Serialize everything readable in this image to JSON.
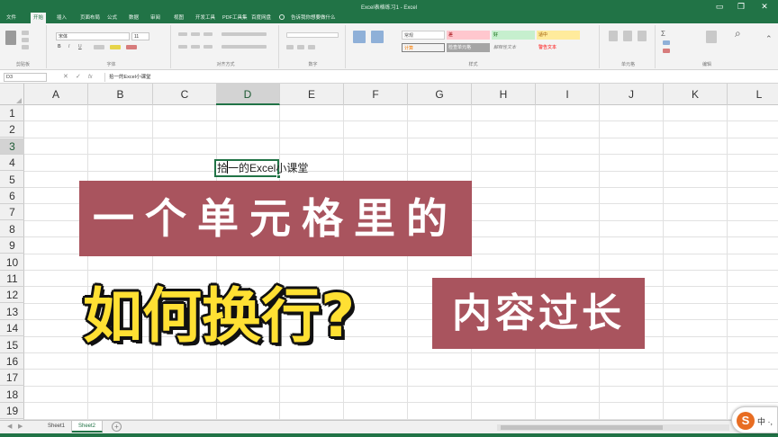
{
  "window": {
    "title": "Excel表格练习1 - Excel",
    "controls": {
      "restore": "❐",
      "close": "✕"
    }
  },
  "tabs": [
    "文件",
    "开始",
    "插入",
    "页面布局",
    "公式",
    "数据",
    "审阅",
    "视图",
    "开发工具",
    "PDF工具集",
    "百度网盘",
    "告诉我你想要做什么"
  ],
  "ribbon": {
    "groups": [
      "剪贴板",
      "字体",
      "对齐方式",
      "数字",
      "样式",
      "单元格",
      "编辑"
    ],
    "font_name": "宋体",
    "font_size": "11",
    "styles": [
      "常规",
      "差",
      "好",
      "适中",
      "计算",
      "检查单元格",
      "解释性文本",
      "警告文本"
    ]
  },
  "formula_bar": {
    "name_box": "D3",
    "cancel_icon": "✕",
    "enter_icon": "✓",
    "fx_icon": "fx",
    "value": "拾一的Excel小课堂"
  },
  "grid": {
    "columns": [
      "A",
      "B",
      "C",
      "D",
      "E",
      "F",
      "G",
      "H",
      "I",
      "J",
      "K",
      "L"
    ],
    "rows": [
      "1",
      "2",
      "3",
      "4",
      "5",
      "6",
      "7",
      "8",
      "9",
      "10",
      "11",
      "12",
      "13",
      "14",
      "15",
      "16",
      "17",
      "18",
      "19"
    ],
    "selected_column": "D",
    "selected_row": "3",
    "active_cell_text": "拾一的Excel小课堂"
  },
  "overlay": {
    "banner_top": "一个单元格里的",
    "banner_right": "内容过长",
    "headline": "如何换行?"
  },
  "sheets": {
    "tabs": [
      "Sheet1",
      "Sheet2"
    ],
    "active": "Sheet2",
    "add_label": "+"
  },
  "ime": {
    "logo": "S",
    "text": "中 ·,"
  },
  "colors": {
    "excel_green": "#217346",
    "banner": "#a9545e",
    "headline": "#ffe033"
  }
}
